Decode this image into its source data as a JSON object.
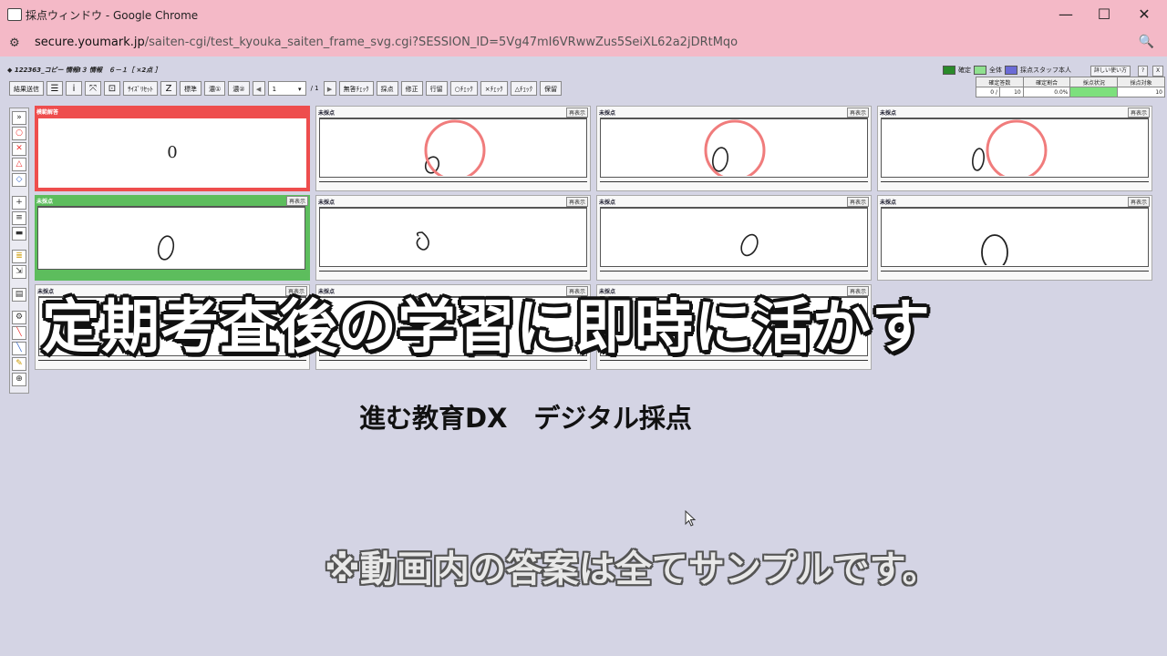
{
  "window": {
    "title": "採点ウィンドウ - Google Chrome",
    "minimize": "—",
    "maximize": "☐",
    "close": "✕"
  },
  "address": {
    "domain": "secure.youmark.jp",
    "path": "/saiten-cgi/test_kyouka_saiten_frame_svg.cgi?SESSION_ID=5Vg47mI6VRwwZus5SeiXL62a2jDRtMqo"
  },
  "header": {
    "line": "◆ 122363_コピー 情報Ⅰ３ 情報　６－１［ ×2点 ］"
  },
  "toolbar": {
    "send": "結果送信",
    "list": "☰",
    "info": "i",
    "fit": "⤧",
    "frame": "⊡",
    "size_reset": "ｻｲｽﾞﾘｾｯﾄ",
    "z": "Z",
    "standard": "標準",
    "density1": "濃①",
    "density2": "濃②",
    "prev": "◀",
    "page_select": "1",
    "page_total": "/ 1",
    "next": "▶",
    "unanswered_check": "無答ﾁｪｯｸ",
    "grade": "採点",
    "fix": "修正",
    "line": "行留",
    "check_o": "○ﾁｪｯｸ",
    "check_x": "×ﾁｪｯｸ",
    "check_tri": "△ﾁｪｯｸ",
    "hold": "保留"
  },
  "legend": {
    "confirmed": "確定",
    "all": "全体",
    "staff": "採点スタッフ本人",
    "usage": "詳しい使い方",
    "help": "?",
    "close": "X"
  },
  "stats": {
    "h_confirmed": "確定答数",
    "h_rate": "確定割合",
    "h_status": "採点状況",
    "h_target": "採点対象",
    "confirmed": "0 /",
    "confirmed_total": "10",
    "rate": "0.0%",
    "target": "10"
  },
  "sidebar": [
    "»",
    "○",
    "✕",
    "△",
    "◇",
    "+",
    "≡",
    "▬",
    "≣",
    "⇲",
    "▤",
    "⚙",
    "╲",
    "╲",
    "✎",
    "⊕"
  ],
  "cards": [
    {
      "label": "模範解答",
      "value": "0"
    },
    {
      "label": "未採点",
      "btn": "再表示"
    },
    {
      "label": "未採点",
      "btn": "再表示"
    },
    {
      "label": "未採点",
      "btn": "再表示"
    },
    {
      "label": "未採点",
      "btn": "再表示"
    },
    {
      "label": "未採点",
      "btn": "再表示"
    },
    {
      "label": "未採点",
      "btn": "再表示"
    },
    {
      "label": "未採点",
      "btn": "再表示"
    },
    {
      "label": "未採点",
      "btn": "再表示"
    },
    {
      "label": "未採点",
      "btn": "再表示"
    },
    {
      "label": "未採点",
      "btn": "再表示"
    }
  ],
  "overlay": {
    "title": "定期考査後の学習に即時に活かす",
    "sub": "進む教育DX　デジタル採点",
    "note": "※動画内の答案は全てサンプルです。"
  },
  "colors": {
    "titlebar": "#f4b9c7",
    "app_bg": "#d4d4e4",
    "model_answer": "#ee4d4d",
    "selected": "#5dbd5d",
    "grade_circle": "#f07c7c"
  }
}
